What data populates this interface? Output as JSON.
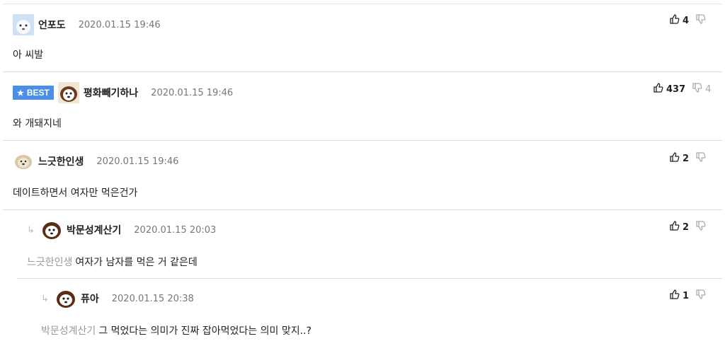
{
  "comments": [
    {
      "nickname": "언포도",
      "date": "2020.01.15 19:46",
      "text": "아 씨발",
      "up": "4",
      "down": ""
    },
    {
      "badge": "BEST",
      "nickname": "평화빼기하나",
      "date": "2020.01.15 19:46",
      "text": "와 개돼지네",
      "up": "437",
      "down": "4"
    },
    {
      "nickname": "느긋한인생",
      "date": "2020.01.15 19:46",
      "text": "데이트하면서 여자만 먹은건가",
      "up": "2",
      "down": ""
    },
    {
      "nickname": "박문성계산기",
      "date": "2020.01.15 20:03",
      "mention": "느긋한인생",
      "text": "여자가 남자를 먹은 거 같은데",
      "up": "2",
      "down": ""
    },
    {
      "nickname": "퓨아",
      "date": "2020.01.15 20:38",
      "mention": "박문성계산기",
      "text": "그 먹었다는 의미가 진짜 잡아먹었다는 의미 맞지..?",
      "up": "1",
      "down": ""
    }
  ],
  "icons": {
    "upvote": "thumbs-up-icon",
    "downvote": "thumbs-down-icon",
    "reply": "reply-arrow-icon",
    "star": "star-icon"
  },
  "colors": {
    "best_badge": "#4a8ee8",
    "mention": "#999999",
    "date": "#777777",
    "separator": "#dcdcdc"
  }
}
